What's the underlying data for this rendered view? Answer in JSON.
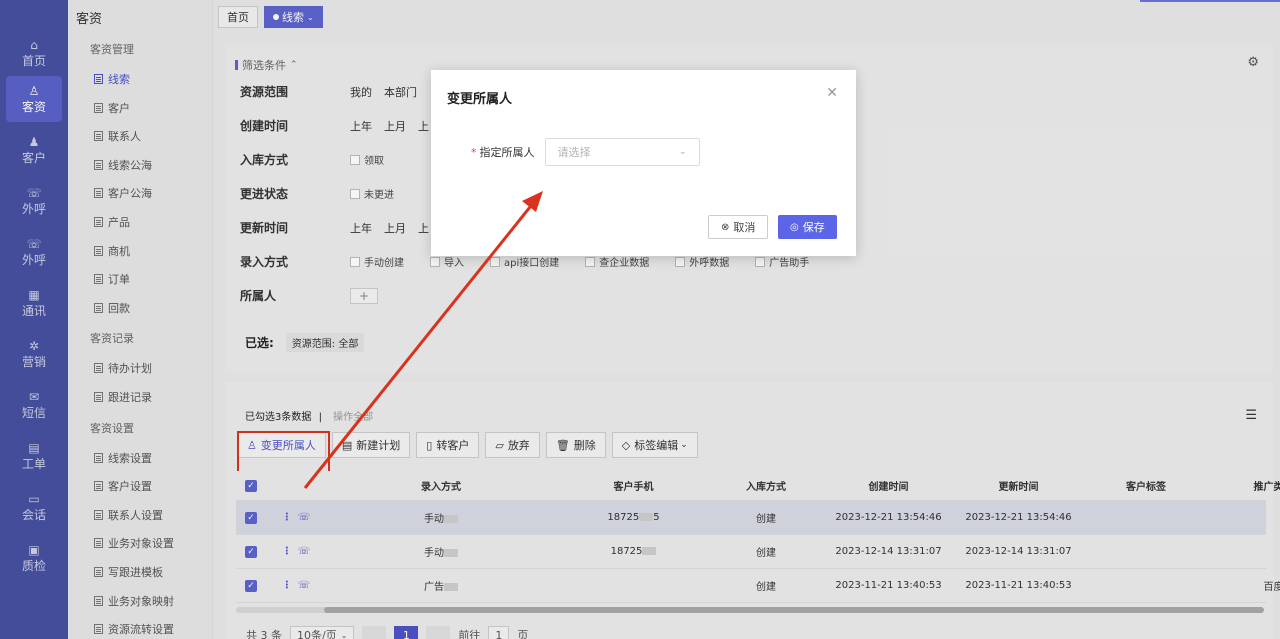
{
  "rail": [
    {
      "label": "首页",
      "icon": "home-icon",
      "glyph": "⌂"
    },
    {
      "label": "客资",
      "icon": "users-icon",
      "glyph": "♙",
      "active": true
    },
    {
      "label": "客户",
      "icon": "user-icon",
      "glyph": "♟"
    },
    {
      "label": "外呼",
      "icon": "phone-icon",
      "glyph": "☏"
    },
    {
      "label": "外呼",
      "icon": "phone-out-icon",
      "glyph": "☏"
    },
    {
      "label": "通讯",
      "icon": "contacts-icon",
      "glyph": "▦"
    },
    {
      "label": "营销",
      "icon": "marketing-icon",
      "glyph": "✲"
    },
    {
      "label": "短信",
      "icon": "sms-icon",
      "glyph": "✉"
    },
    {
      "label": "工单",
      "icon": "ticket-icon",
      "glyph": "▤"
    },
    {
      "label": "会话",
      "icon": "chat-icon",
      "glyph": "▭"
    },
    {
      "label": "质检",
      "icon": "quality-icon",
      "glyph": "▣"
    }
  ],
  "sidebar": {
    "title": "客资",
    "sections": [
      {
        "title": "客资管理",
        "items": [
          "线索",
          "客户",
          "联系人",
          "线索公海",
          "客户公海",
          "产品",
          "商机",
          "订单",
          "回款"
        ]
      },
      {
        "title": "客资记录",
        "items": [
          "待办计划",
          "跟进记录"
        ]
      },
      {
        "title": "客资设置",
        "items": [
          "线索设置",
          "客户设置",
          "联系人设置",
          "业务对象设置",
          "写跟进模板",
          "业务对象映射",
          "资源流转设置"
        ]
      }
    ],
    "active": "线索"
  },
  "tabs": {
    "home": "首页",
    "current": "线索"
  },
  "filters": {
    "header": "筛选条件",
    "rows": {
      "scope": {
        "label": "资源范围",
        "options": [
          "我的",
          "本部门"
        ]
      },
      "created": {
        "label": "创建时间",
        "options": [
          "上年",
          "上月",
          "上"
        ]
      },
      "inbound": {
        "label": "入库方式",
        "options": [
          "领取"
        ]
      },
      "followup": {
        "label": "更进状态",
        "options": [
          "未更进"
        ]
      },
      "updated": {
        "label": "更新时间",
        "options": [
          "上年",
          "上月",
          "上"
        ]
      },
      "entry": {
        "label": "录入方式",
        "options": [
          "手动创建",
          "导入",
          "api接口创建",
          "查企业数据",
          "外呼数据",
          "广告助手"
        ]
      },
      "owner": {
        "label": "所属人",
        "add": "+"
      }
    },
    "selected_label": "已选:",
    "selected_chip": "资源范围: 全部"
  },
  "list": {
    "selection_info": "已勾选3条数据",
    "select_all": "操作全部",
    "actions": {
      "change_owner": "变更所属人",
      "new_plan": "新建计划",
      "to_customer": "转客户",
      "abandon": "放弃",
      "delete": "删除",
      "tag_edit": "标签编辑"
    },
    "columns": [
      "录入方式",
      "客户手机",
      "入库方式",
      "创建时间",
      "更新时间",
      "客户标签",
      "推广类型"
    ],
    "rows": [
      {
        "entry": "手动",
        "phone": "18725",
        "phone_tail": "5",
        "inbound": "创建",
        "created": "2023-12-21 13:54:46",
        "updated": "2023-12-21 13:54:46",
        "tag": "",
        "promo": ""
      },
      {
        "entry": "手动",
        "phone": "18725",
        "phone_tail": "",
        "inbound": "创建",
        "created": "2023-12-14 13:31:07",
        "updated": "2023-12-14 13:31:07",
        "tag": "",
        "promo": ""
      },
      {
        "entry": "广告",
        "phone": "",
        "phone_tail": "",
        "inbound": "创建",
        "created": "2023-11-21 13:40:53",
        "updated": "2023-11-21 13:40:53",
        "tag": "",
        "promo": "百度"
      }
    ],
    "pager": {
      "total": "共 3 条",
      "size": "10条/页",
      "page": "1",
      "goto": "前往",
      "goto_value": "1",
      "goto_suffix": "页"
    }
  },
  "modal": {
    "title": "变更所属人",
    "field_label": "指定所属人",
    "required_mark": "*",
    "placeholder": "请选择",
    "cancel": "取消",
    "save": "保存"
  },
  "colors": {
    "accent": "#5c64e8",
    "highlight": "#d9321e",
    "rail": "#3f4a74"
  }
}
